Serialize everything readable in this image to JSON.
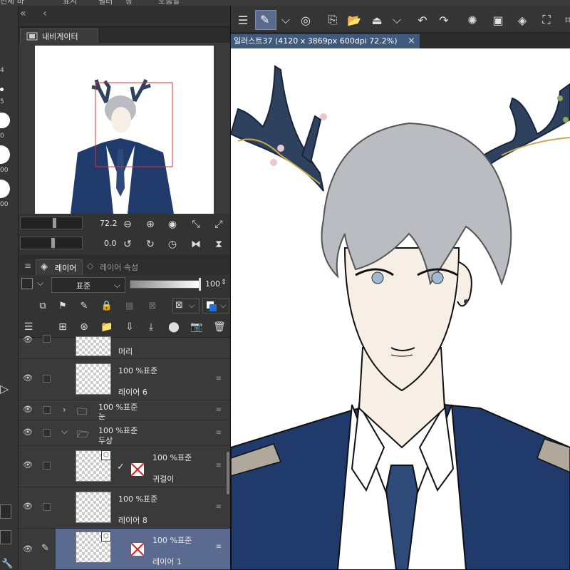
{
  "menu": {
    "items": [
      "전체 바",
      "표시",
      "필터",
      "창",
      "도움말"
    ]
  },
  "left_strip": {
    "sizes": [
      "4",
      "5",
      "0",
      "00",
      "00",
      "00"
    ]
  },
  "navigator": {
    "tab_label": "내비게이터",
    "zoom_value": "72.2",
    "rotation_value": "0.0"
  },
  "layer_panel": {
    "tab_layer": "레이어",
    "tab_props": "레이어 속성",
    "blend_mode": "표준",
    "opacity": "100",
    "layers": [
      {
        "name": "머리",
        "info": ""
      },
      {
        "name": "레이어 6",
        "info": "100 %표준"
      },
      {
        "name": "눈",
        "info": "100 %표준"
      },
      {
        "name": "두상",
        "info": "100 %표준"
      },
      {
        "name": "귀걸이",
        "info": "100 %표준"
      },
      {
        "name": "레이어 8",
        "info": "100 %표준"
      },
      {
        "name": "레이어 1",
        "info": "100 %표준"
      }
    ]
  },
  "document": {
    "tab_title": "일러스트37 (4120 x 3869px 600dpi 72.2%)",
    "close": "×"
  },
  "colors": {
    "accent": "#3f5a7d",
    "selection": "#5b6b8f",
    "panel": "#3a3a3a",
    "antler": "#2e4260",
    "hair": "#b9bcc0",
    "coat": "#1f3a6b"
  },
  "icons": [
    "menu-icon",
    "pen-icon",
    "chevron-down-icon",
    "target-icon",
    "new-layer-icon",
    "folder-icon",
    "fill-icon",
    "undo-icon",
    "redo-icon",
    "spinner-icon",
    "paint-bucket-icon",
    "transform-icon",
    "eye-icon",
    "lock-icon",
    "trash-icon"
  ]
}
